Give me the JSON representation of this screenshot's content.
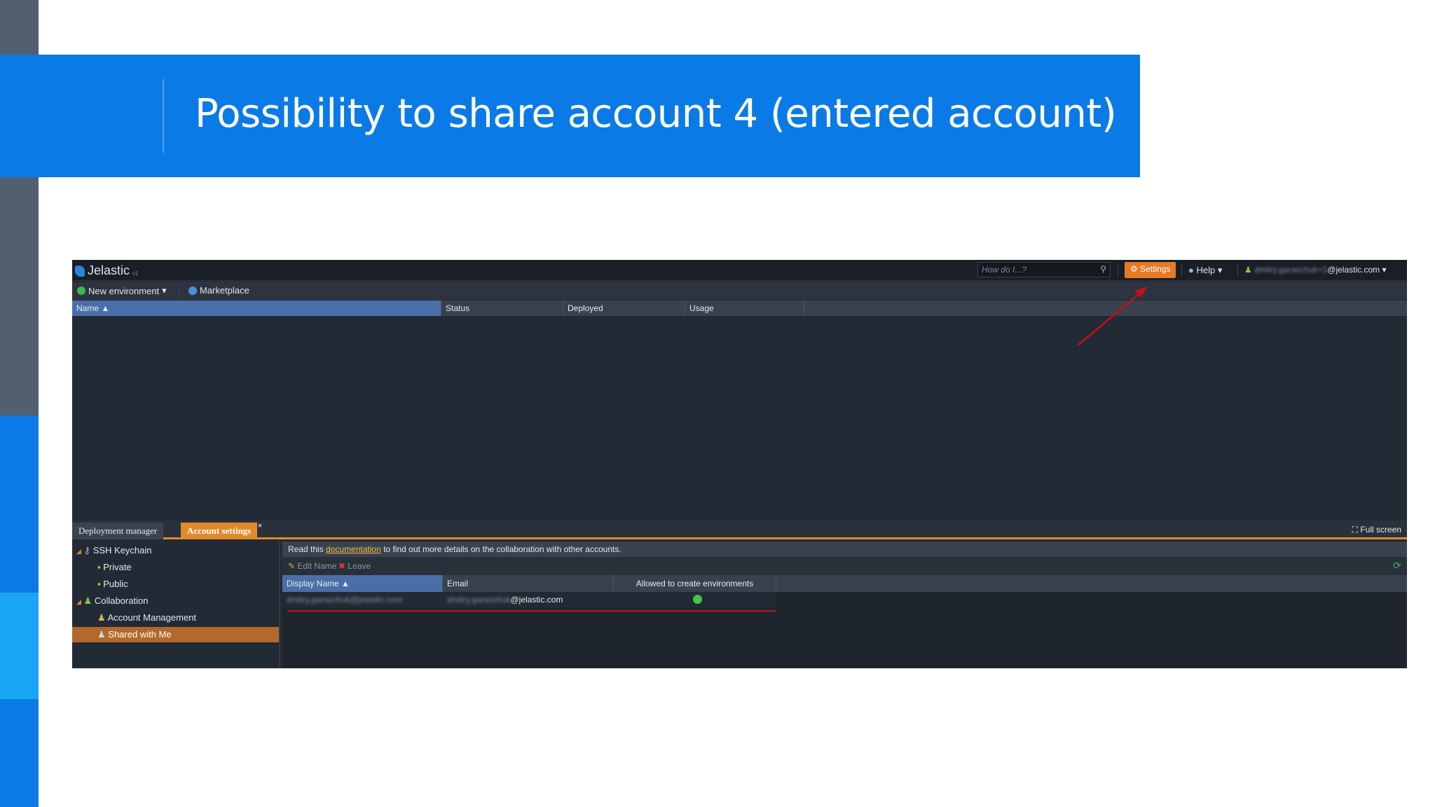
{
  "slide": {
    "title": "Possibility to share account 4 (entered account)"
  },
  "app": {
    "logo": {
      "name": "Jelastic",
      "version": "v1"
    },
    "search_placeholder": "How do I...?",
    "settings_label": "Settings",
    "help_label": "Help",
    "user": {
      "blurred": "dmitry.garaschuk+1",
      "suffix": "@jelastic.com"
    },
    "toolbar": {
      "new_env": "New environment",
      "marketplace": "Marketplace"
    },
    "grid_columns": [
      "Name",
      "Status",
      "Deployed",
      "Usage"
    ],
    "tabs": {
      "deployment": "Deployment manager",
      "account": "Account settings",
      "close": "×",
      "fullscreen": "Full screen"
    },
    "tree": [
      "SSH Keychain",
      "Private",
      "Public",
      "Collaboration",
      "Account Management",
      "Shared with Me"
    ],
    "info": {
      "prefix": "Read this",
      "link": "documentation",
      "suffix": "to find out more details on the collaboration with other accounts."
    },
    "actions": {
      "edit": "Edit Name",
      "leave": "Leave"
    },
    "table_columns": [
      "Display Name",
      "Email",
      "Allowed to create environments"
    ],
    "row": {
      "display_name": "dmitry.garaschuk@jelastic.com",
      "email_blurred": "dmitry.garaschuk",
      "email_suffix": "@jelastic.com",
      "allowed": true
    }
  },
  "colors": {
    "accent": "#0a7ae6",
    "orange": "#e08a2c",
    "annotation_red": "#c0101a"
  }
}
